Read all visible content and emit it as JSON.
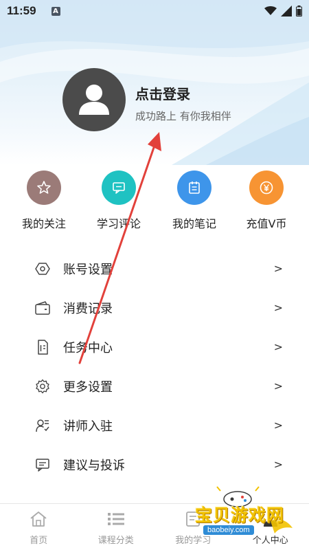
{
  "status_bar": {
    "time": "11:59",
    "notification_badge": "A"
  },
  "profile": {
    "title": "点击登录",
    "subtitle": "成功路上 有你我相伴"
  },
  "quick_actions": [
    {
      "label": "我的关注",
      "icon": "star-icon",
      "color": "#9b7b78"
    },
    {
      "label": "学习评论",
      "icon": "comment-icon",
      "color": "#1fc2c2"
    },
    {
      "label": "我的笔记",
      "icon": "notebook-icon",
      "color": "#3e95ea"
    },
    {
      "label": "充值V币",
      "icon": "yen-icon",
      "color": "#f79433"
    }
  ],
  "menu": [
    {
      "label": "账号设置",
      "icon": "hexagon-settings-icon"
    },
    {
      "label": "消费记录",
      "icon": "wallet-icon"
    },
    {
      "label": "任务中心",
      "icon": "task-list-icon"
    },
    {
      "label": "更多设置",
      "icon": "gear-icon"
    },
    {
      "label": "讲师入驻",
      "icon": "teacher-icon"
    },
    {
      "label": "建议与投诉",
      "icon": "feedback-icon"
    }
  ],
  "menu_chevron": ">",
  "bottom_nav": [
    {
      "label": "首页",
      "icon": "home-icon",
      "active": false
    },
    {
      "label": "课程分类",
      "icon": "category-icon",
      "active": false
    },
    {
      "label": "我的学习",
      "icon": "study-icon",
      "active": false
    },
    {
      "label": "个人中心",
      "icon": "person-icon",
      "active": true
    }
  ],
  "watermark": {
    "text": "宝贝游戏网",
    "url": "baobeiy.com"
  },
  "colors": {
    "avatar_bg": "#4b4b4b",
    "arrow": "#e2413b"
  }
}
